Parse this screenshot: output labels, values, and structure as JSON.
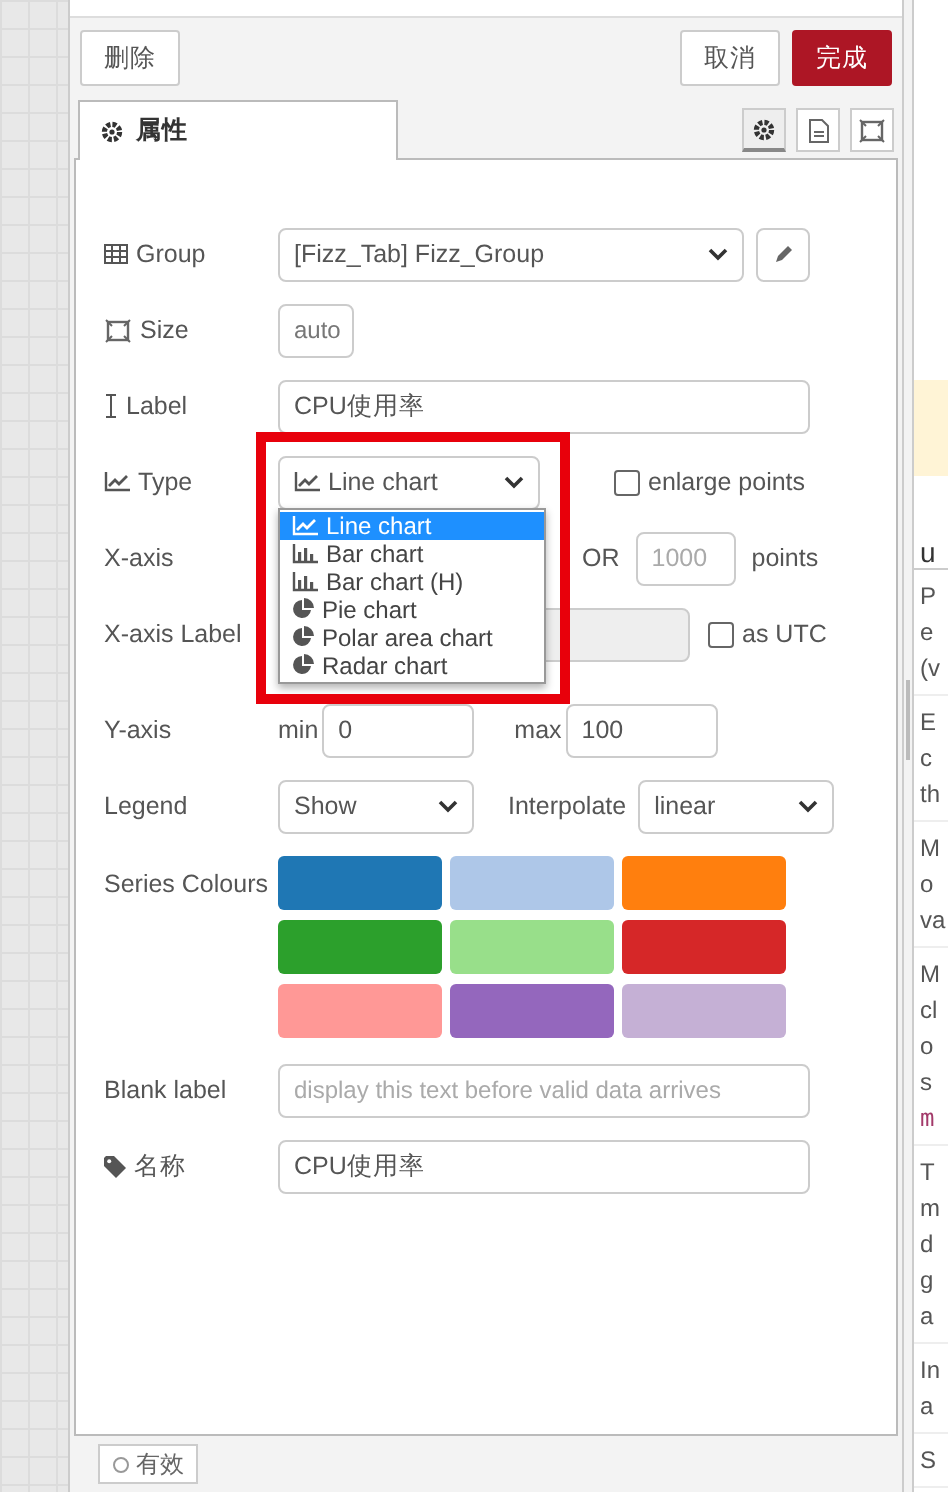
{
  "toolbar": {
    "delete_button": "删除",
    "cancel_button": "取消",
    "done_button": "完成"
  },
  "tabs": [
    {
      "label": "属性",
      "selected": true
    }
  ],
  "tab_icons": [
    {
      "kind": "gear",
      "selected": true
    },
    {
      "kind": "document",
      "selected": false
    },
    {
      "kind": "frame",
      "selected": false
    }
  ],
  "form": {
    "group": {
      "label": "Group",
      "value": "[Fizz_Tab] Fizz_Group"
    },
    "size": {
      "label": "Size",
      "value": "auto"
    },
    "label": {
      "label": "Label",
      "value": "CPU使用率"
    },
    "type": {
      "label": "Type",
      "value": "Line chart",
      "enlarge_points": {
        "label": "enlarge points",
        "checked": false
      },
      "options": [
        {
          "label": "Line chart",
          "kind": "line",
          "selected": true
        },
        {
          "label": "Bar chart",
          "kind": "bar",
          "selected": false
        },
        {
          "label": "Bar chart (H)",
          "kind": "bar",
          "selected": false
        },
        {
          "label": "Pie chart",
          "kind": "pie",
          "selected": false
        },
        {
          "label": "Polar area chart",
          "kind": "pie",
          "selected": false
        },
        {
          "label": "Radar chart",
          "kind": "pie",
          "selected": false
        }
      ]
    },
    "x_axis": {
      "label": "X-axis",
      "or": "OR",
      "points_placeholder": "1000",
      "points": "points"
    },
    "x_axis_label": {
      "label": "X-axis Label",
      "as_utc": {
        "label": "as UTC",
        "checked": false
      }
    },
    "y_axis": {
      "label": "Y-axis",
      "min_label": "min",
      "min": "0",
      "max_label": "max",
      "max": "100"
    },
    "legend": {
      "label": "Legend",
      "value": "Show"
    },
    "interpolate": {
      "label": "Interpolate",
      "value": "linear"
    },
    "series_colours": {
      "label": "Series Colours",
      "colors": [
        {
          "color": "#1f77b4"
        },
        {
          "color": "#aec7e8"
        },
        {
          "color": "#ff7f0e"
        },
        {
          "color": "#2ca02c"
        },
        {
          "color": "#98df8a"
        },
        {
          "color": "#d62728"
        },
        {
          "color": "#ff9896"
        },
        {
          "color": "#9467bd"
        },
        {
          "color": "#c5b0d5"
        }
      ]
    },
    "blank_label": {
      "label": "Blank label",
      "placeholder": "display this text before valid data arrives"
    },
    "name": {
      "label": "名称",
      "value": "CPU使用率"
    }
  },
  "footer": {
    "enabled_button": "有效"
  },
  "help_panel": {
    "heading": "u",
    "paragraphs": [
      [
        {
          "text": "P"
        },
        {
          "text": "e"
        },
        {
          "text": "(v"
        }
      ],
      [
        {
          "text": "E"
        },
        {
          "text": "c"
        },
        {
          "text": "th"
        }
      ],
      [
        {
          "text": "M"
        },
        {
          "text": "o"
        },
        {
          "text": "va"
        }
      ],
      [
        {
          "text": "M"
        },
        {
          "text": "cl"
        },
        {
          "text": "o"
        },
        {
          "text": "s"
        },
        {
          "text": "m",
          "kind": "code"
        }
      ],
      [
        {
          "text": "T"
        },
        {
          "text": "m"
        },
        {
          "text": "d"
        },
        {
          "text": "g"
        },
        {
          "text": "a"
        }
      ],
      [
        {
          "text": "In"
        },
        {
          "text": "a"
        }
      ],
      [
        {
          "text": "S"
        }
      ]
    ]
  }
}
